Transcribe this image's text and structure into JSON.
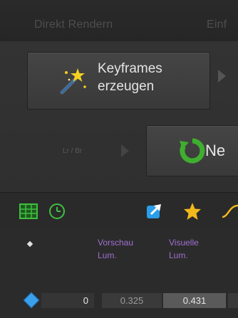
{
  "tabs": [
    {
      "label": "Direkt Rendern"
    },
    {
      "label": "Einf"
    }
  ],
  "toolbar": {
    "keyframes_line1": "Keyframes",
    "keyframes_line2": "erzeugen",
    "lrbr_label": "Lr / Br",
    "new_button_label": "Ne"
  },
  "table": {
    "columns": [
      {
        "line1": "Vorschau",
        "line2": "Lum."
      },
      {
        "line1": "Visuelle",
        "line2": "Lum."
      }
    ],
    "rows": [
      {
        "index": "0",
        "preview_lum": "0.325",
        "visual_lum": "0.431"
      }
    ]
  },
  "colors": {
    "accent_purple": "#a070d0",
    "keyframe_blue": "#3aa0ee",
    "refresh_green": "#3fae2f",
    "star_yellow": "#f2b81c"
  },
  "icons": [
    "magic-wand-icon",
    "refresh-icon",
    "grid-table-icon",
    "clock-icon",
    "export-icon",
    "star-icon",
    "curve-icon"
  ]
}
